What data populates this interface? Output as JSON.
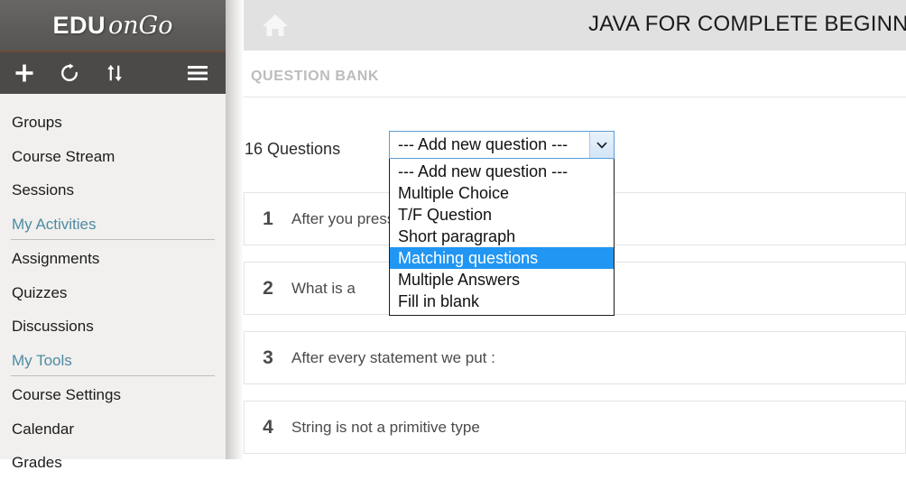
{
  "sidebar": {
    "logo": {
      "primary": "EDU",
      "secondary": "onGo"
    },
    "toolbar": [
      {
        "name": "add-icon",
        "label": "+"
      },
      {
        "name": "refresh-icon",
        "label": "↻"
      },
      {
        "name": "sort-icon",
        "label": "⇅"
      },
      {
        "name": "menu-icon",
        "label": "☰"
      }
    ],
    "items": [
      {
        "label": "Groups",
        "type": "item"
      },
      {
        "label": "Course Stream",
        "type": "item"
      },
      {
        "label": "Sessions",
        "type": "item"
      },
      {
        "label": "My Activities",
        "type": "section"
      },
      {
        "label": "Assignments",
        "type": "item"
      },
      {
        "label": "Quizzes",
        "type": "item"
      },
      {
        "label": "Discussions",
        "type": "item"
      },
      {
        "label": "My Tools",
        "type": "section"
      },
      {
        "label": "Course Settings",
        "type": "item"
      },
      {
        "label": "Calendar",
        "type": "item"
      },
      {
        "label": "Grades",
        "type": "item"
      }
    ]
  },
  "header": {
    "home_icon": "home-icon",
    "course_title": "JAVA FOR COMPLETE BEGINNER"
  },
  "main": {
    "section_title": "QUESTION BANK",
    "question_count": "16 Questions",
    "add_question_select": {
      "value": "--- Add new question ---",
      "arrow": "⌄",
      "expanded": true,
      "selected": "Matching questions",
      "options": [
        "--- Add new question ---",
        "Multiple Choice",
        "T/F Question",
        "Short paragraph",
        "Matching questions",
        "Multiple Answers",
        "Fill in blank"
      ]
    },
    "questions": [
      {
        "num": "1",
        "text": "After you                                     press:"
      },
      {
        "num": "2",
        "text": "What is a"
      },
      {
        "num": "3",
        "text": "After every statement we put :"
      },
      {
        "num": "4",
        "text": "String is not a primitive type"
      }
    ]
  },
  "colors": {
    "sidebar_bg": "#f1f0ee",
    "logo_bar": "#5c5b59",
    "toolbar_bg": "#4b4a48",
    "accent_teal": "#4e8ba3",
    "header_bg": "#e2e1e1",
    "highlight_blue": "#2196f3",
    "focus_border": "#5b9dd9"
  }
}
